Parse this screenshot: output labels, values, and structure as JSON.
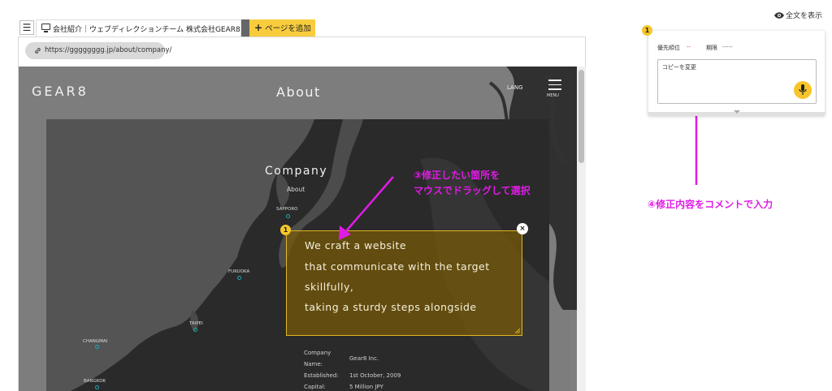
{
  "tabbar": {
    "menu_glyph": "☰",
    "tab_title": "会社紹介｜ウェブディレクションチーム 株式会社GEAR8",
    "add_page_plus": "+",
    "add_page_label": "ページを追加"
  },
  "browser": {
    "url": "https://gggggggg.jp/about/company/"
  },
  "site": {
    "logo": "GEAR8",
    "header_title": "About",
    "lang": "LANG",
    "menu": "MENU",
    "section_title": "Company",
    "section_sub": "About",
    "cities": [
      "SAPPORO",
      "FUKUOKA",
      "TAIPEI",
      "CHANGMAI",
      "BANGKOK"
    ],
    "selection_lines": [
      "We craft a website",
      "that communicate with the target",
      "skillfully,",
      "taking a sturdy steps alongside"
    ],
    "selection_badge": "1",
    "close_glyph": "×",
    "info": {
      "labels": [
        "Company",
        "Name:",
        "Established:",
        "Capital:"
      ],
      "values": [
        "Gear8 Inc.",
        "1st October, 2009",
        "5 Million JPY"
      ]
    }
  },
  "annotations": {
    "step3_line1": "③修正したい箇所を",
    "step3_line2": "マウスでドラッグして選択",
    "step4": "④修正内容をコメントで入力"
  },
  "panel": {
    "show_all": "全文を表示",
    "badge": "1",
    "priority_label": "優先順位",
    "priority_value": "--",
    "deadline_label": "期限",
    "deadline_value": "-----",
    "comment": "コピーを変更"
  },
  "colors": {
    "accent_yellow": "#f4c629",
    "annotation_magenta": "#e01be6",
    "city_marker": "#1aa9b0",
    "priority_red": "#e03030"
  }
}
